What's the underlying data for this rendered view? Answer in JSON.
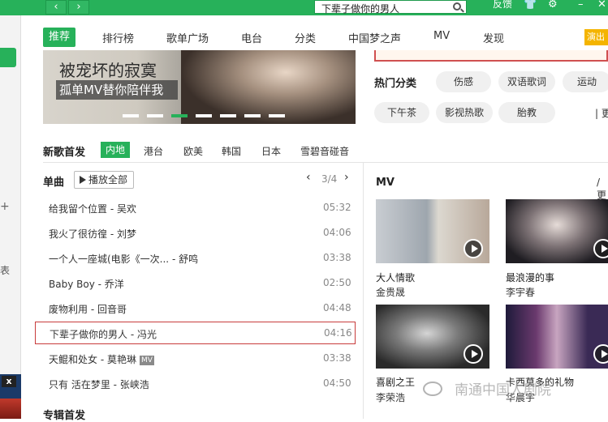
{
  "titlebar": {
    "back": "‹",
    "forward": "›",
    "search_value": "下辈子做你的男人",
    "feedback": "反馈",
    "shirt_icon": "shirt-icon",
    "gear_icon": "gear-icon",
    "minimize": "–",
    "close": "✕"
  },
  "nav": {
    "items": [
      "推荐",
      "排行榜",
      "歌单广场",
      "电台",
      "分类",
      "中国梦之声",
      "MV",
      "发现"
    ],
    "concert": "演出"
  },
  "banner": {
    "line1": "被宠坏的寂寞",
    "line2": "孤单MV替你陪伴我",
    "dot_count": 7,
    "active_dot": 3
  },
  "hot": {
    "title": "热门分类",
    "tags": [
      "伤感",
      "双语歌词",
      "运动",
      "下午茶",
      "影视热歌",
      "胎教"
    ],
    "more": "| 更"
  },
  "new_songs": {
    "title": "新歌首发",
    "regions": [
      "内地",
      "港台",
      "欧美",
      "韩国",
      "日本",
      "雪碧音碰音"
    ],
    "single_title": "单曲",
    "play_all": "播放全部",
    "pager": "3/4",
    "songs": [
      {
        "name": "给我留个位置 - 吴欢",
        "duration": "05:32"
      },
      {
        "name": "我火了很彷徨 - 刘梦",
        "duration": "04:06"
      },
      {
        "name": "一个人一座城(电影《一次...  - 舒鸣",
        "duration": "03:38"
      },
      {
        "name": "Baby Boy - 乔洋",
        "duration": "02:50"
      },
      {
        "name": "废物利用 - 回音哥",
        "duration": "04:48"
      },
      {
        "name": "下辈子做你的男人 - 冯光",
        "duration": "04:16"
      },
      {
        "name": "天鲲和处女 - 莫艳琳",
        "duration": "03:38",
        "mv": "MV"
      },
      {
        "name": "只有 活在梦里 - 张峡浩",
        "duration": "04:50"
      }
    ],
    "album_title": "专辑首发"
  },
  "mv": {
    "title": "MV",
    "more": "/更",
    "items": [
      {
        "name": "大人情歌",
        "artist": "金贵晟"
      },
      {
        "name": "最浪漫的事",
        "artist": "李宇春"
      },
      {
        "name": "喜剧之王",
        "artist": "李荣浩"
      },
      {
        "name": "卡西莫多的礼物",
        "artist": "华晨宇"
      }
    ]
  },
  "watermark": "南通中国人剧院",
  "sidebar": {
    "plus": "+",
    "label": "表",
    "ad_close": "x"
  }
}
